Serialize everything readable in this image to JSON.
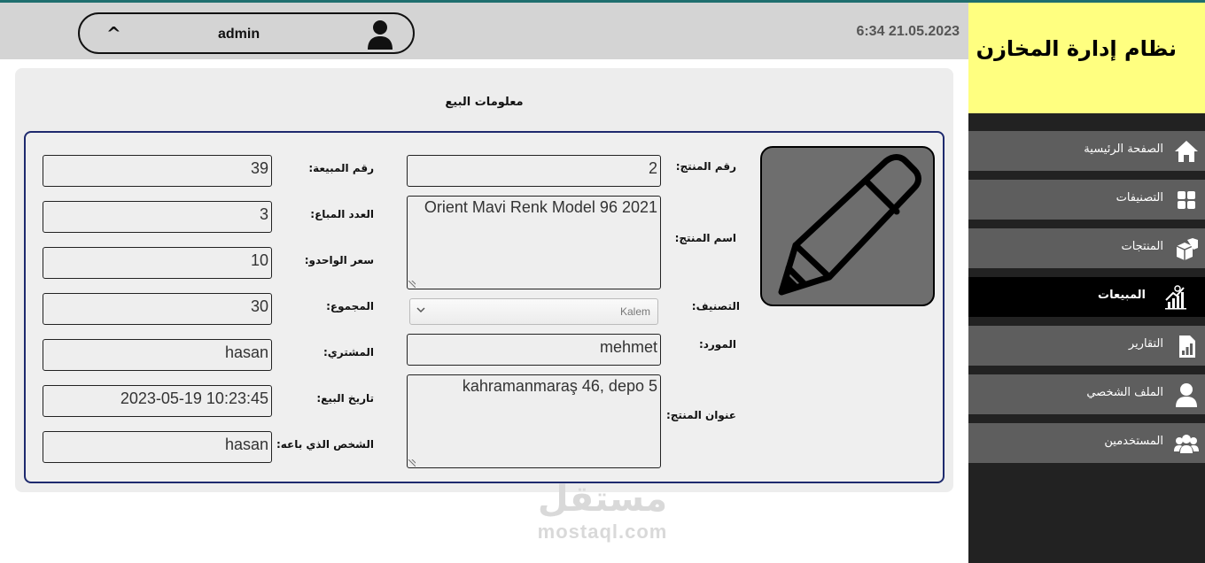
{
  "header": {
    "user_caret": "^",
    "username": "admin",
    "datetime": "6:34 21.05.2023"
  },
  "sidebar": {
    "brand_title": "نظام إدارة المخازن",
    "brand_bg": "#ffff80",
    "items": [
      {
        "label": "الصفحة الرئيسية",
        "icon": "home-icon"
      },
      {
        "label": "التصنيفات",
        "icon": "grid-icon"
      },
      {
        "label": "المنتجات",
        "icon": "boxes-icon"
      },
      {
        "label": "المبيعات",
        "icon": "sales-chart-icon",
        "active": true
      },
      {
        "label": "التقارير",
        "icon": "report-icon"
      },
      {
        "label": "الملف الشخصي",
        "icon": "user-icon"
      },
      {
        "label": "المستخدمين",
        "icon": "users-icon"
      }
    ]
  },
  "panel": {
    "title": "معلومات البيع",
    "left": {
      "sale_number": {
        "label": "رقم المبيعة:",
        "value": "39"
      },
      "quantity_sold": {
        "label": "العدد المباع:",
        "value": "3"
      },
      "unit_price": {
        "label": "سعر الواحدو:",
        "value": "10"
      },
      "total": {
        "label": "المجموع:",
        "value": "30"
      },
      "buyer": {
        "label": "المشتري:",
        "value": "hasan"
      },
      "sale_date": {
        "label": "تاريخ البيع:",
        "value": "2023-05-19 10:23:45"
      },
      "seller": {
        "label": "الشخص الذي باعه:",
        "value": "hasan"
      }
    },
    "right": {
      "product_number": {
        "label": "رقم المنتج:",
        "value": "2"
      },
      "product_name": {
        "label": "اسم المنتج:",
        "value": "Orient Mavi Renk Model 96 2021"
      },
      "category": {
        "label": "التصنيف:",
        "value": "Kalem"
      },
      "supplier": {
        "label": "المورد:",
        "value": "mehmet"
      },
      "product_address": {
        "label": "عنوان المنتج:",
        "value": "kahramanmaraş 46, depo 5"
      }
    }
  },
  "watermark": {
    "arabic": "مستقل",
    "latin": "mostaql.com"
  },
  "colors": {
    "accent_border": "#1e2a6e",
    "sidebar_bg": "#222222",
    "nav_bg": "#5e5e5e",
    "header_bg": "#d4d4d4"
  }
}
